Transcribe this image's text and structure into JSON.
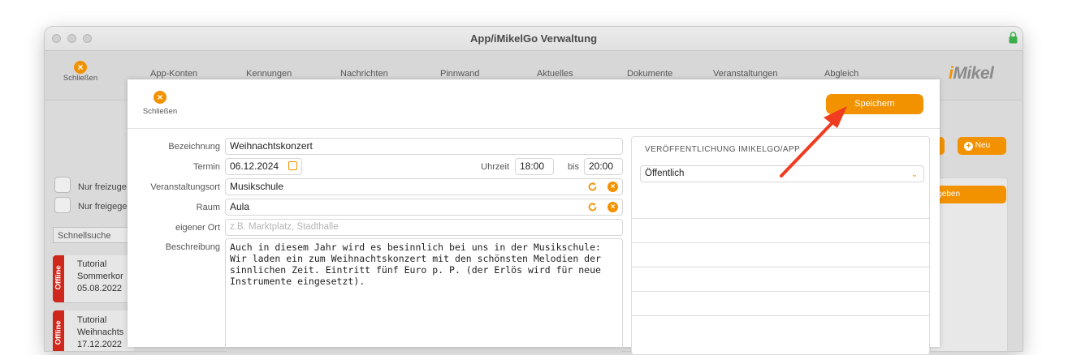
{
  "window": {
    "title": "App/iMikelGo Verwaltung"
  },
  "toolbar": {
    "close_label": "Schließen",
    "nav": [
      "App-Konten",
      "Kennungen",
      "Nachrichten",
      "Pinnwand",
      "Aktuelles",
      "Dokumente",
      "Veranstaltungen",
      "Abgleich"
    ],
    "logo_prefix": "i",
    "logo_rest": "Mikel"
  },
  "background": {
    "filter_1": "Nur freizuge",
    "filter_2": "Nur freigege",
    "search_placeholder": "Schnellsuche",
    "new_button": "Neu",
    "btn_partial": "n",
    "approve_partial": "igeben",
    "side_t": "t",
    "offline_label": "Offline",
    "cards": [
      {
        "line1": "Tutorial",
        "line2": "Sommerkor",
        "line3": "05.08.2022"
      },
      {
        "line1": "Tutorial",
        "line2": "Weihnachts",
        "line3": "17.12.2022"
      }
    ]
  },
  "dialog": {
    "close_label": "Schließen",
    "save_label": "Speichern",
    "labels": {
      "bezeichnung": "Bezeichnung",
      "termin": "Termin",
      "uhrzeit": "Uhrzeit",
      "bis": "bis",
      "ort": "Veranstaltungsort",
      "raum": "Raum",
      "eigener_ort": "eigener Ort",
      "beschreibung": "Beschreibung"
    },
    "values": {
      "bezeichnung": "Weihnachtskonzert",
      "termin": "06.12.2024",
      "uhrzeit_von": "18:00",
      "uhrzeit_bis": "20:00",
      "ort": "Musikschule",
      "raum": "Aula",
      "eigener_ort_placeholder": "z.B. Marktplatz, Stadthalle",
      "beschreibung": "Auch in diesem Jahr wird es besinnlich bei uns in der Musikschule: Wir laden ein zum Weihnachtskonzert mit den schönsten Melodien der sinnlichen Zeit. Eintritt fünf Euro p. P. (der Erlös wird für neue Instrumente eingesetzt)."
    },
    "publication": {
      "title": "VERÖFFENTLICHUNG IMIKELGO/APP",
      "selected": "Öffentlich"
    }
  },
  "colors": {
    "accent": "#f39200",
    "offline": "#d0271d",
    "arrow": "#f03c20"
  }
}
